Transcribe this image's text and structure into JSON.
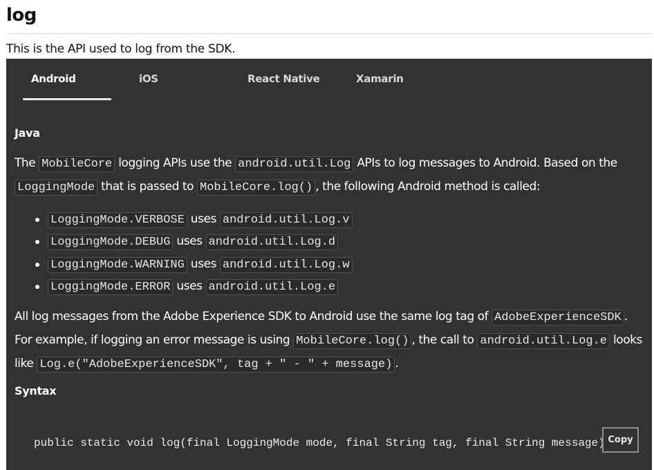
{
  "page": {
    "title": "log",
    "intro": "This is the API used to log from the SDK."
  },
  "tabs": [
    {
      "label": "Android",
      "active": true
    },
    {
      "label": "iOS",
      "active": false
    },
    {
      "label": "React Native",
      "active": false
    },
    {
      "label": "Xamarin",
      "active": false
    }
  ],
  "java": {
    "heading": "Java",
    "p1": {
      "t1": "The ",
      "c1": "MobileCore",
      "t2": " logging APIs use the ",
      "c2": "android.util.Log",
      "t3": " APIs to log messages to Android. Based on the ",
      "c3": "LoggingMode",
      "t4": " that is passed to ",
      "c4": "MobileCore.log()",
      "t5": ", the following Android method is called:"
    },
    "bullets": [
      {
        "mode": "LoggingMode.VERBOSE",
        "uses": " uses ",
        "method": "android.util.Log.v"
      },
      {
        "mode": "LoggingMode.DEBUG",
        "uses": " uses ",
        "method": "android.util.Log.d"
      },
      {
        "mode": "LoggingMode.WARNING",
        "uses": " uses ",
        "method": "android.util.Log.w"
      },
      {
        "mode": "LoggingMode.ERROR",
        "uses": " uses ",
        "method": "android.util.Log.e"
      }
    ],
    "p2": {
      "t1": "All log messages from the Adobe Experience SDK to Android use the same log tag of ",
      "c1": "AdobeExperienceSDK",
      "t2": ". For example, if logging an error message is using ",
      "c2": "MobileCore.log()",
      "t3": ", the call to ",
      "c3": "android.util.Log.e",
      "t4": " looks like ",
      "c4": "Log.e(\"AdobeExperienceSDK\", tag + \" - \" + message)",
      "t5": "."
    },
    "syntax_heading": "Syntax",
    "code": "public static void log(final LoggingMode mode, final String tag, final String message)",
    "copy_label": "Copy"
  }
}
